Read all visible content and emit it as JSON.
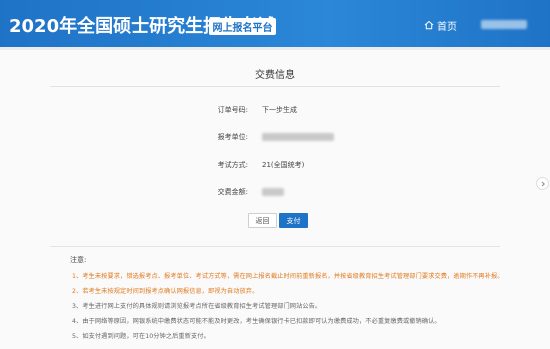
{
  "header": {
    "site_title": "2020年全国硕士研究生招生考试",
    "platform_badge": "网上报名平台",
    "home_label": "首页"
  },
  "main": {
    "title": "交费信息",
    "fields": [
      {
        "label": "订单号码:",
        "value": "下一步生成"
      },
      {
        "label": "报考单位:",
        "value": ""
      },
      {
        "label": "考试方式:",
        "value": "21(全国统考)"
      },
      {
        "label": "交费金额:",
        "value": ""
      }
    ],
    "buttons": {
      "back_label": "返回",
      "pay_label": "支付"
    }
  },
  "notes": {
    "heading": "注意:",
    "items": [
      "1、考生未按要求，错选报考点、报考单位、考试方式等，需在网上报名截止时间前重新报名，并按省级教育招生考试管理部门要求交费，逾期作不再补报。",
      "2、若考生未按规定时间到报考点确认网报信息，即视为自动放弃。",
      "3、考生进行网上支付的具体规则请浏览报考点所在省级教育招生考试管理部门网站公告。",
      "4、由于网络等原因，网银系统中缴费状态可能不能及时更改，考生确保银行卡已扣款即可认为缴费成功，不必重复缴费或撤销确认。",
      "5、如支付遇到问题，可在10分钟之后重新支付。"
    ]
  },
  "colors": {
    "header_blue": "#1f73c7",
    "note_orange": "#e07a1e"
  }
}
